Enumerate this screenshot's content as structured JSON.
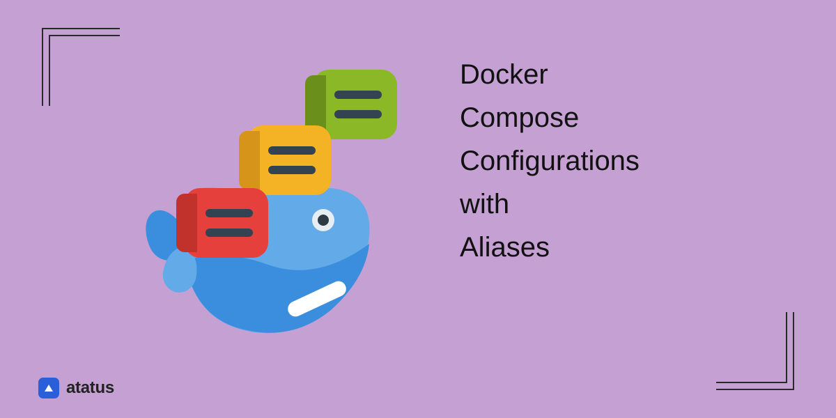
{
  "title_lines": [
    "Docker",
    "Compose",
    "Configurations",
    "with",
    "Aliases"
  ],
  "brand": {
    "name": "atatus"
  },
  "illustration": {
    "subject": "docker-whale",
    "containers": [
      {
        "color": "red"
      },
      {
        "color": "yellow"
      },
      {
        "color": "green"
      }
    ]
  },
  "colors": {
    "background": "#c4a0d3",
    "text": "#111111",
    "brand_accent": "#2b5fd9"
  }
}
